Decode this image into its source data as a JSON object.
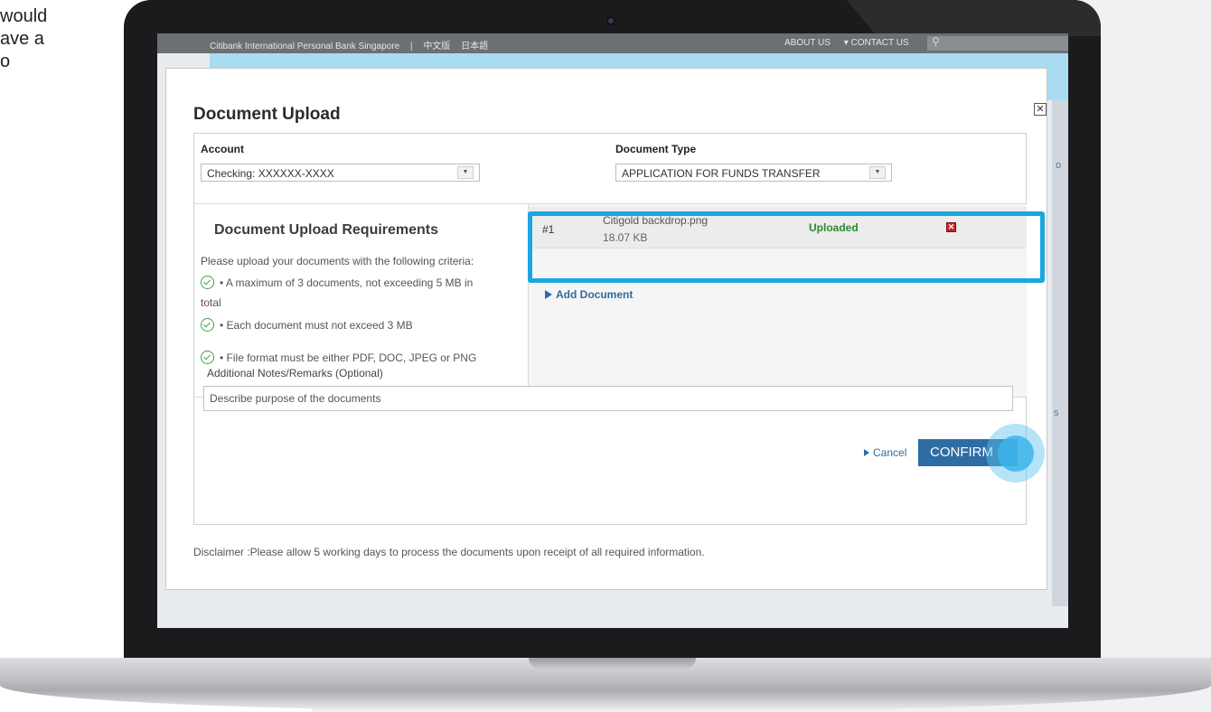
{
  "side_text": [
    "would",
    "ave a",
    "o"
  ],
  "topnav": {
    "site": "Citibank International Personal Bank Singapore",
    "separator": "|",
    "lang_chinese": "中文版",
    "lang_japanese": "日本語",
    "about": "ABOUT US",
    "contact": "▾ CONTACT US",
    "search_icon": "⚲"
  },
  "dim_side": {
    "t1": "o",
    "t2": "s"
  },
  "modal": {
    "close": "✕",
    "title": "Document Upload",
    "account_label": "Account",
    "account_value": "Checking: XXXXXX-XXXX",
    "doctype_label": "Document Type",
    "doctype_value": "APPLICATION FOR FUNDS TRANSFER",
    "select_arrow": "▼",
    "requirements": {
      "title": "Document Upload Requirements",
      "intro": "Please upload your documents with the following criteria:",
      "item1_line1": "• A maximum of 3 documents, not exceeding 5 MB in",
      "item1_line2": "total",
      "item2": "• Each document must not exceed 3 MB",
      "item3": "• File format must be either PDF, DOC, JPEG or PNG"
    },
    "document": {
      "number": "#1",
      "name": "Citigold backdrop.png",
      "size": "18.07 KB",
      "status": "Uploaded",
      "delete_icon": "✕"
    },
    "add_document": "Add Document",
    "notes_label": "Additional Notes/Remarks (Optional)",
    "notes_placeholder": "Describe purpose of the documents",
    "cancel": "Cancel",
    "confirm": "CONFIRM",
    "disclaimer": "Disclaimer :Please allow 5 working days to process the documents upon receipt of all required information."
  },
  "colors": {
    "accent_blue": "#2d6da3",
    "highlight": "#1aa7e1",
    "status_green": "#2c8a2c",
    "delete_red": "#c8202a"
  }
}
